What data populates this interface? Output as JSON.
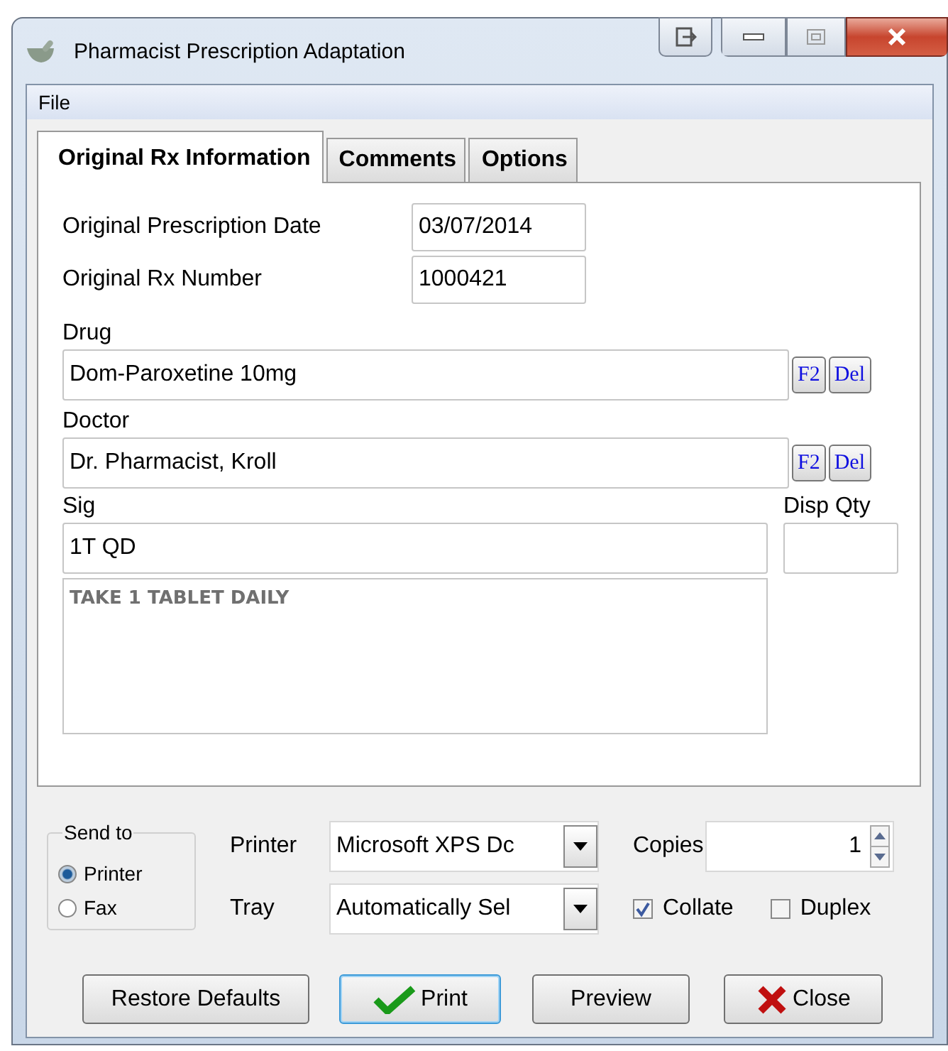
{
  "window": {
    "title": "Pharmacist Prescription Adaptation"
  },
  "menu": [
    {
      "label": "File"
    }
  ],
  "tabs": [
    {
      "label": "Original Rx Information",
      "selected": true
    },
    {
      "label": "Comments",
      "selected": false
    },
    {
      "label": "Options",
      "selected": false
    }
  ],
  "original_date": {
    "label": "Original Prescription Date",
    "value": "03/07/2014"
  },
  "rx_number": {
    "label": "Original Rx Number",
    "value": "1000421"
  },
  "drug": {
    "label": "Drug",
    "value": "Dom-Paroxetine 10mg",
    "buttons": [
      "F2",
      "Del"
    ]
  },
  "doctor": {
    "label": "Doctor",
    "value": "Dr. Pharmacist, Kroll",
    "buttons": [
      "F2",
      "Del"
    ]
  },
  "sig": {
    "label": "Sig",
    "value": "1T QD",
    "description": "TAKE 1 TABLET DAILY"
  },
  "disp_qty": {
    "label": "Disp Qty"
  },
  "send_to": {
    "title": "Send to",
    "options": [
      {
        "label": "Printer",
        "selected": true
      },
      {
        "label": "Fax",
        "selected": false
      }
    ]
  },
  "printer": {
    "label": "Printer",
    "value": "Microsoft XPS Dc"
  },
  "tray": {
    "label": "Tray",
    "value": "Automatically Sel"
  },
  "copies": {
    "label": "Copies",
    "value": "1"
  },
  "checkboxes": [
    {
      "label": "Collate",
      "checked": true
    },
    {
      "label": "Duplex",
      "checked": false
    }
  ],
  "buttons": [
    {
      "label": "Restore Defaults",
      "kind": "plain",
      "default": false
    },
    {
      "label": "Print",
      "kind": "print",
      "default": true
    },
    {
      "label": "Preview",
      "kind": "plain",
      "default": false
    },
    {
      "label": "Close",
      "kind": "close",
      "default": false
    }
  ]
}
